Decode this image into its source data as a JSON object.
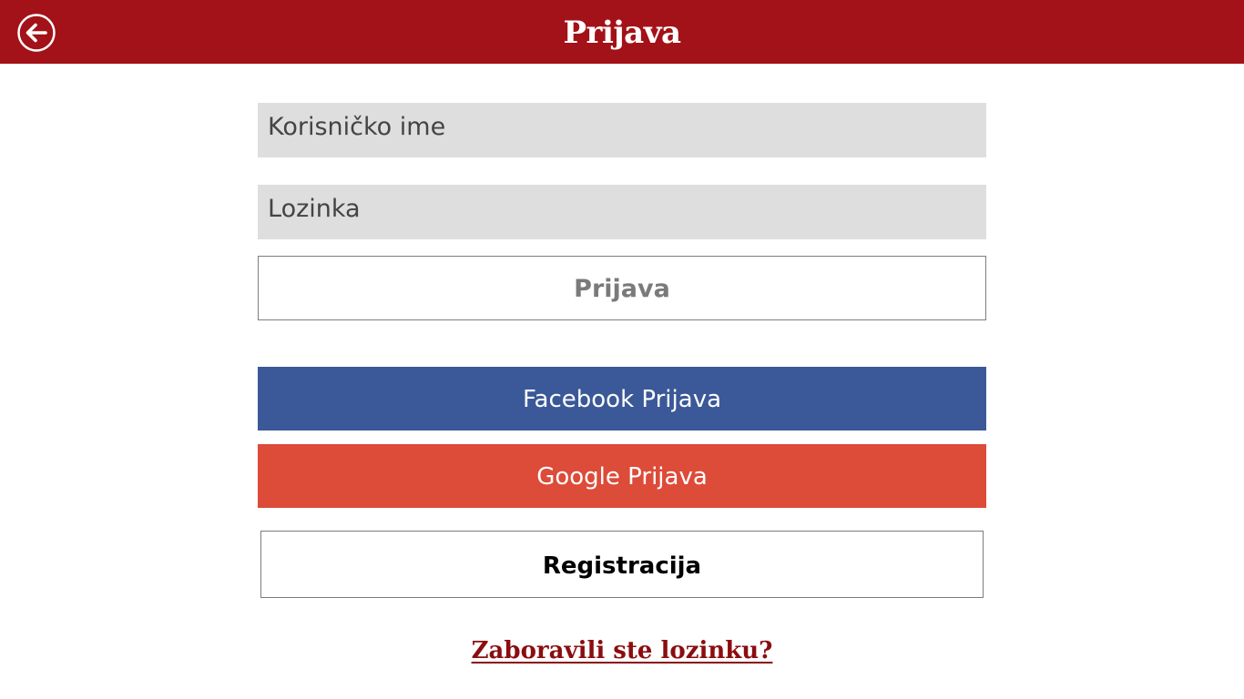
{
  "header": {
    "title": "Prijava",
    "back_icon": "back-arrow-icon",
    "background_color": "#a31218"
  },
  "form": {
    "username_placeholder": "Korisničko ime",
    "username_value": "",
    "password_placeholder": "Lozinka",
    "password_value": "",
    "login_label": "Prijava"
  },
  "social": {
    "facebook_label": "Facebook Prijava",
    "facebook_color": "#3b5998",
    "google_label": "Google Prijava",
    "google_color": "#dd4b39"
  },
  "register_label": "Registracija",
  "forgot_password_label": "Zaboravili ste lozinku?",
  "link_color": "#8b0d10"
}
